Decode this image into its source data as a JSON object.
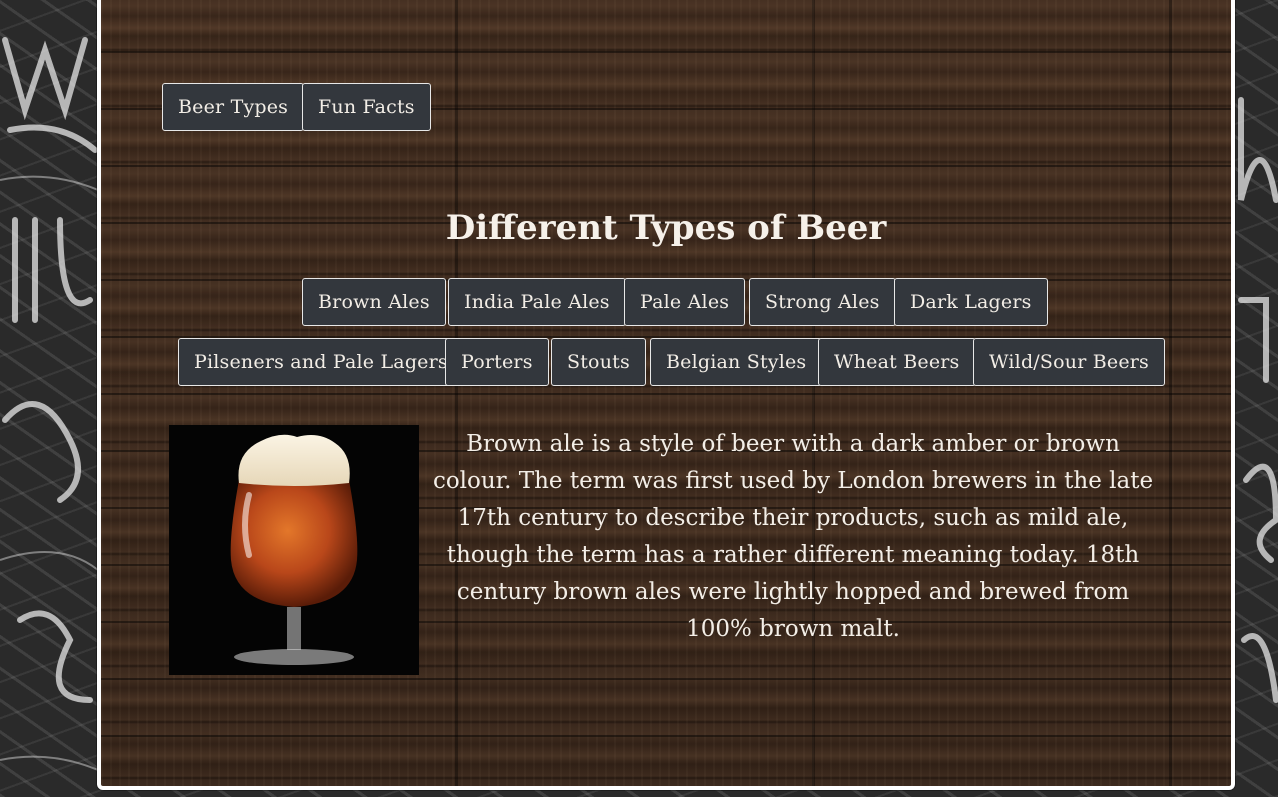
{
  "nav": {
    "beer_types": "Beer Types",
    "fun_facts": "Fun Facts"
  },
  "page": {
    "title": "Different Types of Beer"
  },
  "beer_buttons": {
    "row1": [
      "Brown Ales",
      "India Pale Ales",
      "Pale Ales",
      "Strong Ales",
      "Dark Lagers"
    ],
    "row2": [
      "Pilseners and Pale Lagers",
      "Porters",
      "Stouts",
      "Belgian Styles",
      "Wheat Beers",
      "Wild/Sour Beers"
    ]
  },
  "content": {
    "description": "Brown ale is a style of beer with a dark amber or brown colour. The term was first used by London brewers in the late 17th century to describe their products, such as mild ale, though the term has a rather different meaning today. 18th century brown ales were lightly hopped and brewed from 100% brown malt."
  },
  "colors": {
    "button_bg": "#33373d",
    "button_border": "#e8e8e8",
    "text": "#f3eee7",
    "frame_border": "#ffffff"
  }
}
